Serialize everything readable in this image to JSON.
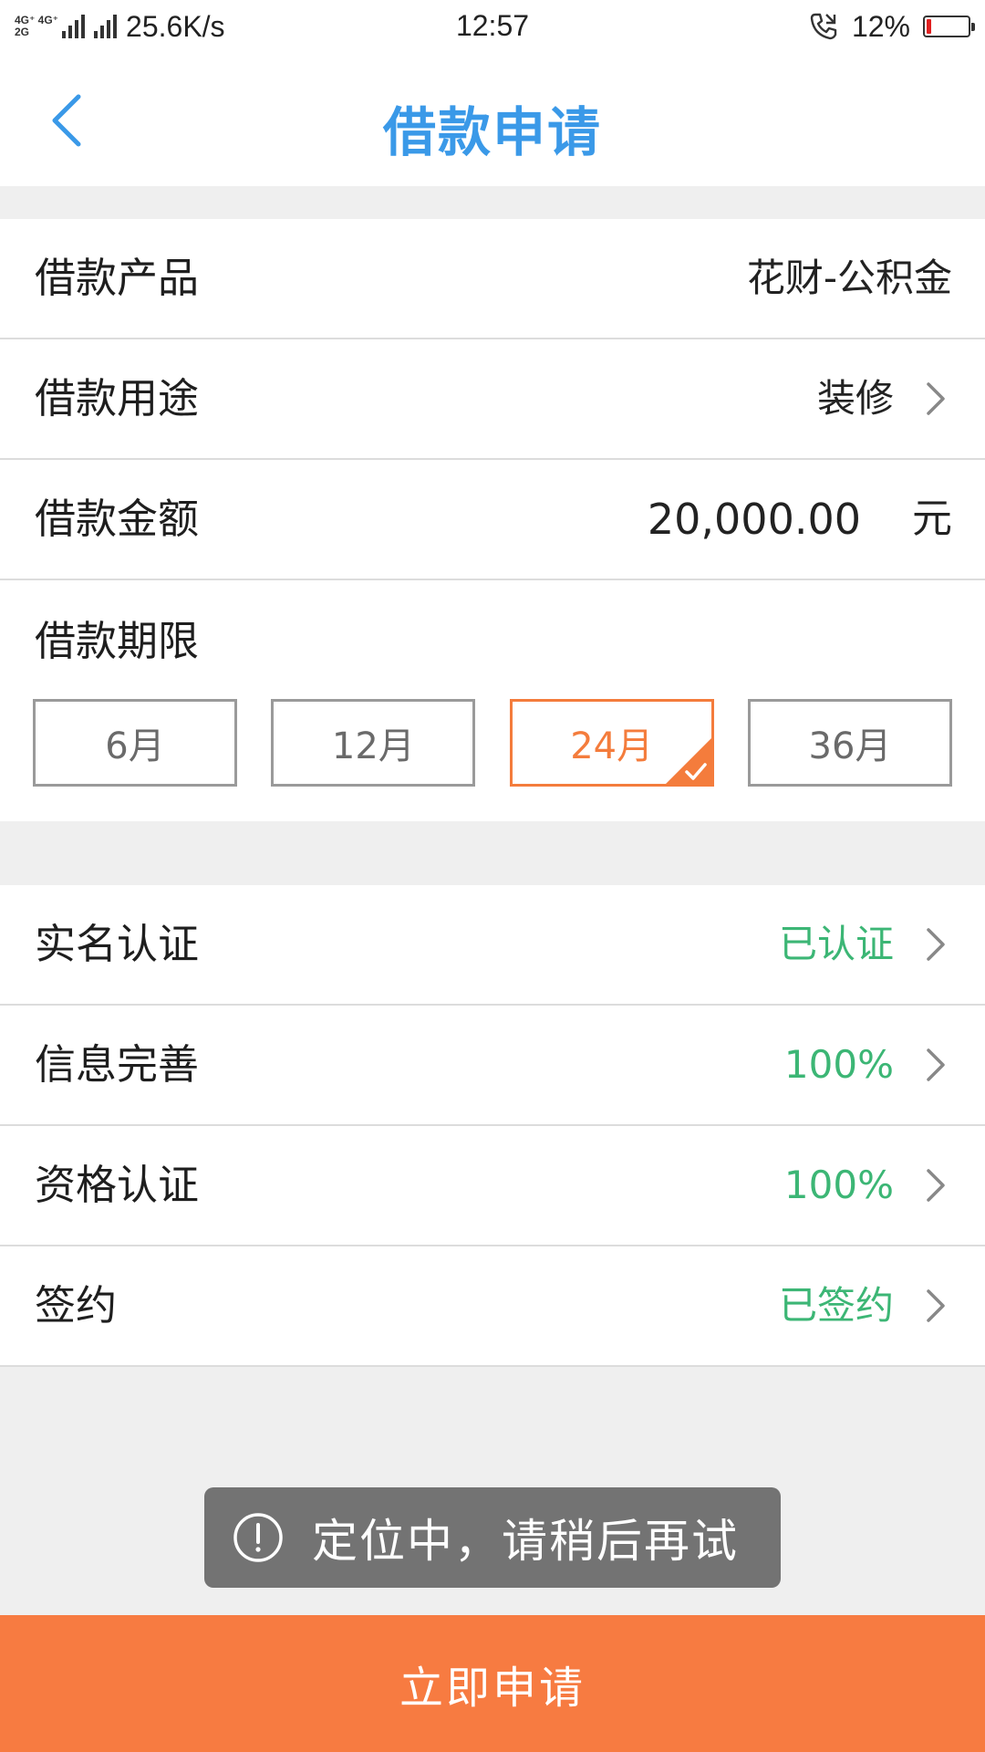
{
  "status_bar": {
    "network_top": "4G⁺ 4G⁺",
    "network_bottom": "2G",
    "speed": "25.6K/s",
    "time": "12:57",
    "battery_text": "12%",
    "battery_level": 0.12,
    "icons": [
      "signal-icon",
      "call-forward-icon",
      "battery-icon"
    ]
  },
  "header": {
    "back_icon": "chevron-left-icon",
    "title": "借款申请"
  },
  "loan_info": {
    "product": {
      "label": "借款产品",
      "value": "花财-公积金"
    },
    "purpose": {
      "label": "借款用途",
      "value": "装修"
    },
    "amount": {
      "label": "借款金额",
      "value": "20,000.00",
      "unit": "元"
    },
    "term": {
      "label": "借款期限",
      "options": [
        "6月",
        "12月",
        "24月",
        "36月"
      ],
      "selected": "24月"
    }
  },
  "verification": {
    "items": [
      {
        "label": "实名认证",
        "status": "已认证"
      },
      {
        "label": "信息完善",
        "status": "100%"
      },
      {
        "label": "资格认证",
        "status": "100%"
      },
      {
        "label": "签约",
        "status": "已签约"
      }
    ]
  },
  "toast": {
    "icon": "exclamation-circle-icon",
    "text": "定位中，请稍后再试"
  },
  "submit_label": "立即申请",
  "colors": {
    "title_blue": "#3a99e8",
    "accent_orange": "#f47c3c",
    "submit_orange": "#f77b41",
    "status_green": "#3cb675",
    "toast_gray": "#737373"
  }
}
